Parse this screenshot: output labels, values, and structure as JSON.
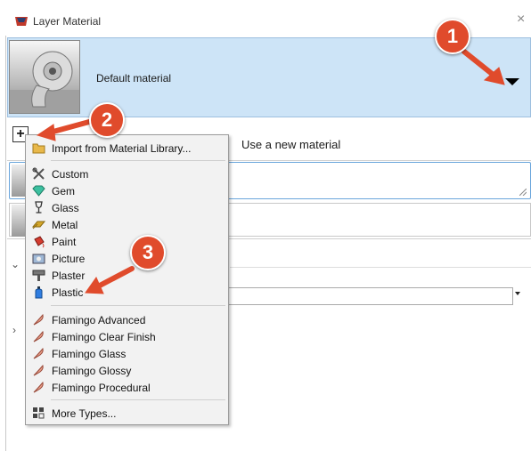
{
  "window": {
    "title": "Layer Material",
    "close_label": "×"
  },
  "material": {
    "name": "Default material"
  },
  "toolbar": {
    "add_label": "+",
    "new_material_label": "Use a new material"
  },
  "menu": {
    "import_label": "Import from Material Library...",
    "types": [
      "Custom",
      "Gem",
      "Glass",
      "Metal",
      "Paint",
      "Picture",
      "Plaster",
      "Plastic"
    ],
    "flamingo": [
      "Flamingo Advanced",
      "Flamingo Clear Finish",
      "Flamingo Glass",
      "Flamingo Glossy",
      "Flamingo Procedural"
    ],
    "more_label": "More Types..."
  },
  "badges": [
    "1",
    "2",
    "3"
  ],
  "sections": {
    "expanded_chevron": "⌄",
    "collapsed_chevron": "›"
  },
  "colors": {
    "badge": "#e04b2c",
    "selection": "#cde4f7",
    "arrow": "#e04b2c"
  }
}
